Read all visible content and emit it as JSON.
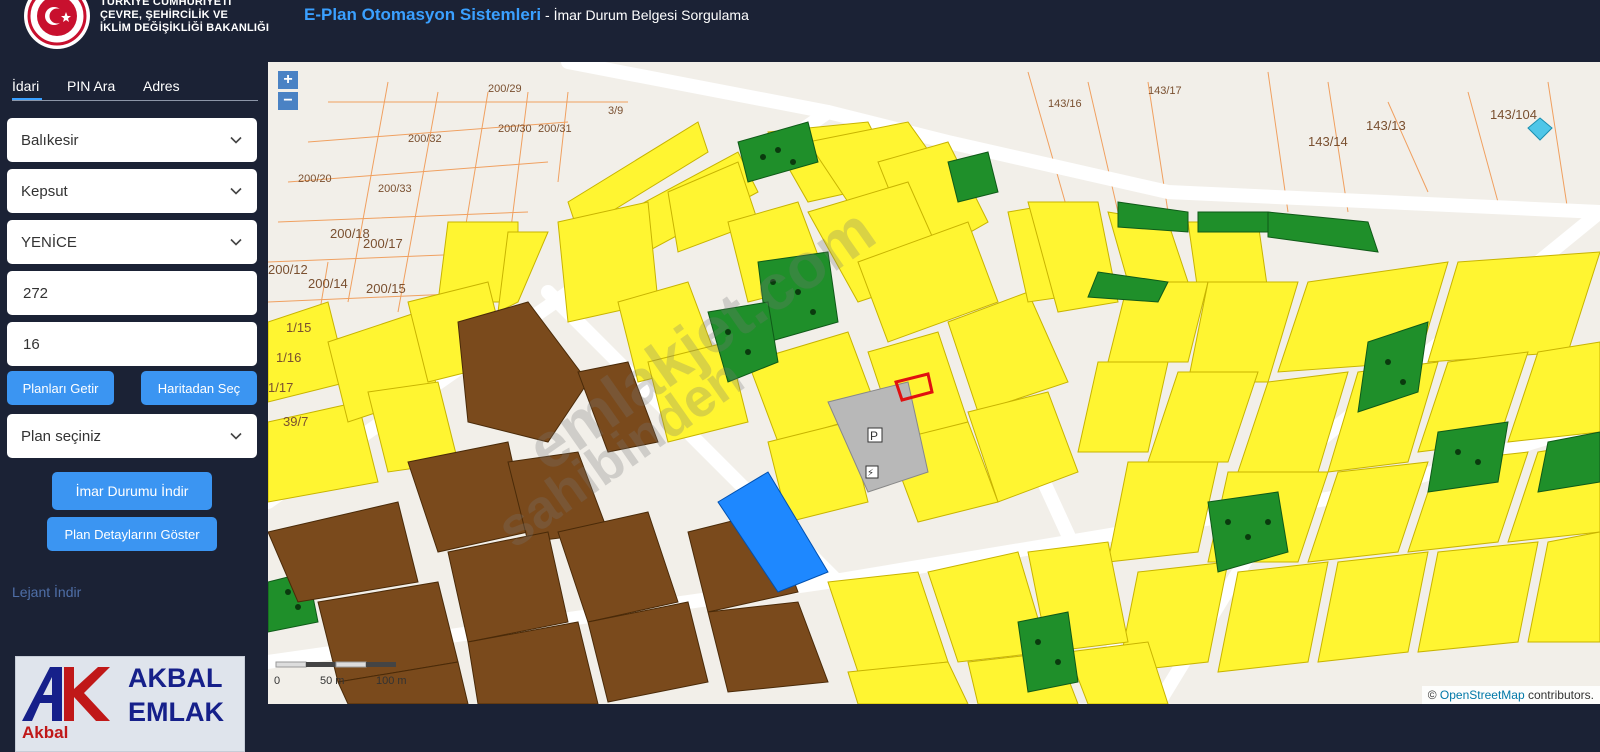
{
  "header": {
    "ministry_line1": "TÜRKİYE CUMHURİYETİ",
    "ministry_line2": "ÇEVRE, ŞEHİRCİLİK VE",
    "ministry_line3": "İKLİM DEĞİŞİKLİĞİ BAKANLIĞI",
    "app_title": "E-Plan Otomasyon Sistemleri",
    "app_subtitle": " - İmar Durum Belgesi Sorgulama"
  },
  "tabs": [
    {
      "label": "İdari",
      "active": true
    },
    {
      "label": "PIN Ara",
      "active": false
    },
    {
      "label": "Adres",
      "active": false
    }
  ],
  "form": {
    "province": "Balıkesir",
    "district": "Kepsut",
    "neighborhood": "YENİCE",
    "block": "272",
    "parcel": "16",
    "btn_get_plans": "Planları Getir",
    "btn_select_map": "Haritadan Seç",
    "plan_select": "Plan seçiniz",
    "btn_download": "İmar Durumu İndir",
    "btn_details": "Plan Detaylarını Göster"
  },
  "legend_label": "Lejant İndir",
  "watermark": {
    "line1": "AKBAL",
    "line2": "EMLAK",
    "akbal": "Akbal",
    "diagonal": "emlakjet.com",
    "diagonal2": "sahibinden"
  },
  "map": {
    "zoom_in": "+",
    "zoom_out": "−",
    "attribution_prefix": "© ",
    "attribution_link": "OpenStreetMap",
    "attribution_suffix": " contributors.",
    "scale_0": "0",
    "scale_50": "50 m",
    "scale_100": "100 m",
    "parcel_labels": [
      {
        "t": "200/29"
      },
      {
        "t": "200/30"
      },
      {
        "t": "200/31"
      },
      {
        "t": "200/32"
      },
      {
        "t": "200/33"
      },
      {
        "t": "200/20"
      },
      {
        "t": "200/18"
      },
      {
        "t": "200/17"
      },
      {
        "t": "200/14"
      },
      {
        "t": "200/15"
      },
      {
        "t": "200/12"
      },
      {
        "t": "1/15"
      },
      {
        "t": "1/16"
      },
      {
        "t": "1/17"
      },
      {
        "t": "39/7"
      },
      {
        "t": "143/14"
      },
      {
        "t": "143/13"
      },
      {
        "t": "143/104"
      },
      {
        "t": "143/16"
      },
      {
        "t": "143/17"
      },
      {
        "t": "3/9"
      }
    ],
    "parking_label": "P",
    "transformer_label": "⚡"
  },
  "colors": {
    "background": "#1b2235",
    "accent": "#3b95f2",
    "residential": "#fff531",
    "green": "#1f8f2a",
    "brown": "#7a4a1c",
    "blue": "#1e88ff",
    "road": "#f2efe9"
  }
}
